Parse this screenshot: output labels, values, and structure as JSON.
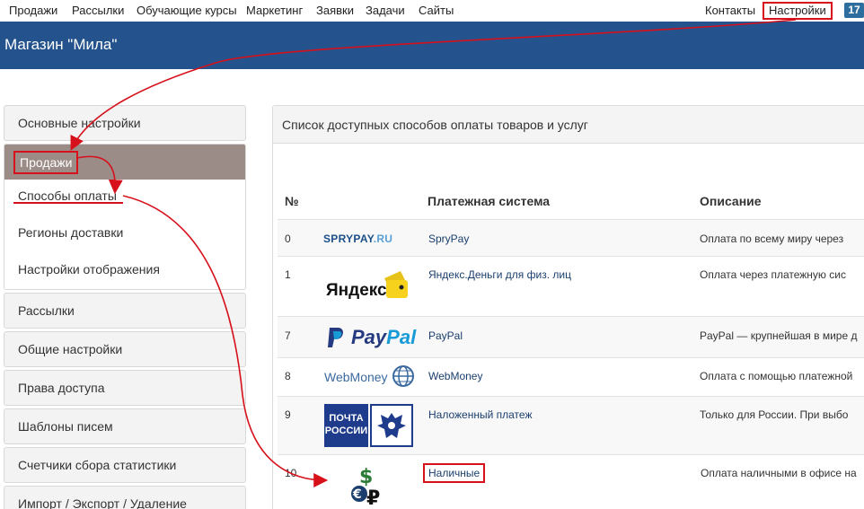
{
  "topnav": {
    "items": [
      "Продажи",
      "Рассылки",
      "Обучающие курсы",
      "Маркетинг",
      "Заявки",
      "Задачи",
      "Сайты"
    ],
    "contacts": "Контакты",
    "settings": "Настройки",
    "badge": "17"
  },
  "header": {
    "title": "Магазин \"Мила\""
  },
  "sidebar": {
    "basic": "Основные настройки",
    "sales": "Продажи",
    "sub": [
      "Способы оплаты",
      "Регионы доставки",
      "Настройки отображения"
    ],
    "rest": [
      "Рассылки",
      "Общие настройки",
      "Права доступа",
      "Шаблоны писем",
      "Счетчики сбора статистики",
      "Импорт / Экспорт / Удаление"
    ]
  },
  "panel": {
    "title": "Список доступных способов оплаты товаров и услуг",
    "columns": {
      "num": "№",
      "system": "Платежная система",
      "desc": "Описание"
    },
    "rows": [
      {
        "num": "0",
        "logo": "SPRYPAY.RU",
        "name": "SpryPay",
        "desc": "Оплата по всему миру через"
      },
      {
        "num": "1",
        "logo": "Яндекс",
        "name": "Яндекс.Деньги для физ. лиц",
        "desc": "Оплата через платежную сис"
      },
      {
        "num": "7",
        "logo": "PayPal",
        "name": "PayPal",
        "desc": "PayPal — крупнейшая в мире д"
      },
      {
        "num": "8",
        "logo": "WebMoney",
        "name": "WebMoney",
        "desc": "Оплата с помощью платежной"
      },
      {
        "num": "9",
        "logo": "ПОЧТА РОССИИ",
        "name": "Наложенный платеж",
        "desc": "Только для России. При выбо"
      },
      {
        "num": "10",
        "logo": "$₽",
        "name": "Наличные",
        "desc": "Оплата наличными в офисе на"
      }
    ]
  },
  "colors": {
    "header": "#23528d",
    "highlight": "#d6111b",
    "active_group": "#9c8c87",
    "badge": "#2e6e9e"
  }
}
